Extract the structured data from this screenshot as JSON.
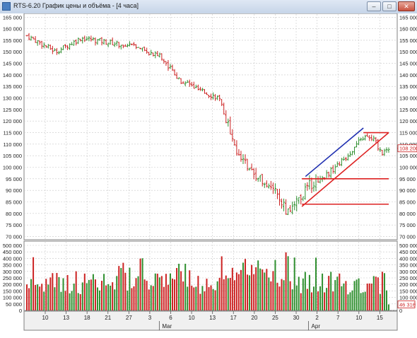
{
  "window": {
    "title": "RTS-6.20 График цены и объёма - [4 часа]",
    "buttons": {
      "minimize": "–",
      "maximize": "□",
      "close": "✕"
    }
  },
  "price_axis": {
    "labels": [
      "165 000",
      "160 000",
      "155 000",
      "150 000",
      "145 000",
      "140 000",
      "135 000",
      "130 000",
      "125 000",
      "120 000",
      "115 000",
      "110 000",
      "105 000",
      "100 000",
      "95 000",
      "90 000",
      "85 000",
      "80 000",
      "75 000",
      "70 000"
    ],
    "current_price": "108 200"
  },
  "volume_axis": {
    "labels": [
      "500 000",
      "450 000",
      "400 000",
      "350 000",
      "300 000",
      "250 000",
      "200 000",
      "150 000",
      "100 000",
      "50 000",
      "0"
    ],
    "current_volume": "46 316"
  },
  "date_axis": {
    "days": [
      "10",
      "13",
      "18",
      "21",
      "27",
      "3",
      "6",
      "10",
      "13",
      "17",
      "20",
      "25",
      "30",
      "2",
      "7",
      "10",
      "15"
    ],
    "months": [
      "Mar",
      "Apr"
    ]
  },
  "colors": {
    "up": "#2f8f2f",
    "down": "#cc2222",
    "trend_blue": "#1f2fb0",
    "trend_red": "#dd2222",
    "grid": "#c8c8c8",
    "current_price": "#cc2222"
  },
  "chart_data": {
    "type": "candlestick",
    "series": "RTS-6.20 4-hour price (ohlc) and volume",
    "price_range": [
      68000,
      166000
    ],
    "volume_range": [
      0,
      500000
    ],
    "key_points": [
      {
        "t": 0,
        "close": 157000
      },
      {
        "t": 0.08,
        "close": 150000
      },
      {
        "t": 0.15,
        "close": 156000
      },
      {
        "t": 0.23,
        "close": 154000
      },
      {
        "t": 0.3,
        "close": 152000
      },
      {
        "t": 0.37,
        "close": 148000
      },
      {
        "t": 0.42,
        "close": 138000
      },
      {
        "t": 0.48,
        "close": 133000
      },
      {
        "t": 0.53,
        "close": 130000
      },
      {
        "t": 0.58,
        "close": 108000
      },
      {
        "t": 0.62,
        "close": 98000
      },
      {
        "t": 0.68,
        "close": 92000
      },
      {
        "t": 0.72,
        "close": 80000
      },
      {
        "t": 0.75,
        "close": 86000
      },
      {
        "t": 0.78,
        "close": 92000
      },
      {
        "t": 0.83,
        "close": 97000
      },
      {
        "t": 0.88,
        "close": 104000
      },
      {
        "t": 0.93,
        "close": 113000
      },
      {
        "t": 0.96,
        "close": 112000
      },
      {
        "t": 0.98,
        "close": 106000
      },
      {
        "t": 1.0,
        "close": 108200
      }
    ],
    "trendlines": [
      {
        "color": "blue",
        "from": [
          0.77,
          96000
        ],
        "to": [
          0.93,
          117000
        ]
      },
      {
        "color": "red",
        "from": [
          0.76,
          83000
        ],
        "to": [
          1.0,
          115000
        ]
      },
      {
        "color": "red",
        "from": [
          0.93,
          115000
        ],
        "to": [
          1.0,
          115000
        ]
      },
      {
        "color": "red",
        "from": [
          0.76,
          95000
        ],
        "to": [
          1.0,
          95000
        ]
      },
      {
        "color": "red",
        "from": [
          0.76,
          84000
        ],
        "to": [
          1.0,
          84000
        ]
      }
    ]
  }
}
